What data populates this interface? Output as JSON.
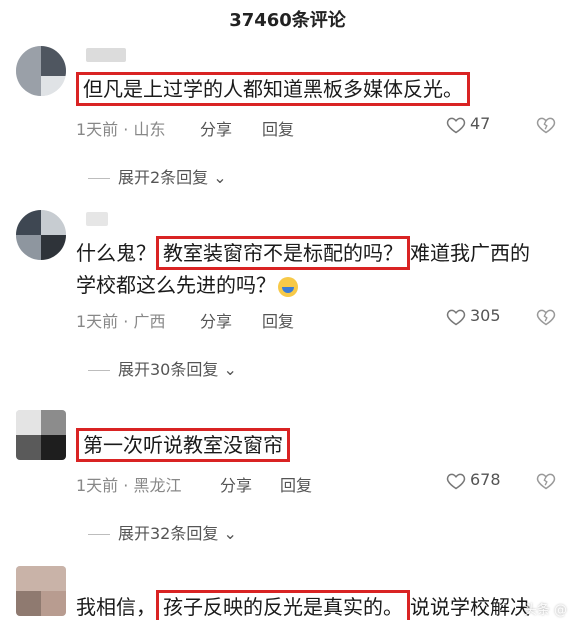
{
  "header": {
    "title": "37460条评论"
  },
  "comments": [
    {
      "text_plain_before": "",
      "text_highlight": "但凡是上过学的人都知道黑板多媒体反光。",
      "text_plain_after": "",
      "time_location": "1天前 · 山东",
      "share_label": "分享",
      "reply_label": "回复",
      "likes": "47",
      "expand_label": "展开2条回复"
    },
    {
      "text_plain_before": "什么鬼？",
      "text_highlight": "教室装窗帘不是标配的吗？",
      "text_plain_after": "难道我广西的",
      "text_line2": "学校都这么先进的吗？",
      "time_location": "1天前 · 广西",
      "share_label": "分享",
      "reply_label": "回复",
      "likes": "305",
      "expand_label": "展开30条回复"
    },
    {
      "text_plain_before": "",
      "text_highlight": "第一次听说教室没窗帘",
      "text_plain_after": "",
      "time_location": "1天前 · 黑龙江",
      "share_label": "分享",
      "reply_label": "回复",
      "likes": "678",
      "expand_label": "展开32条回复"
    },
    {
      "text_plain_before": "我相信，",
      "text_highlight": "孩子反映的反光是真实的。",
      "text_plain_after": "说说学校解决"
    }
  ],
  "watermark": "头条 @"
}
